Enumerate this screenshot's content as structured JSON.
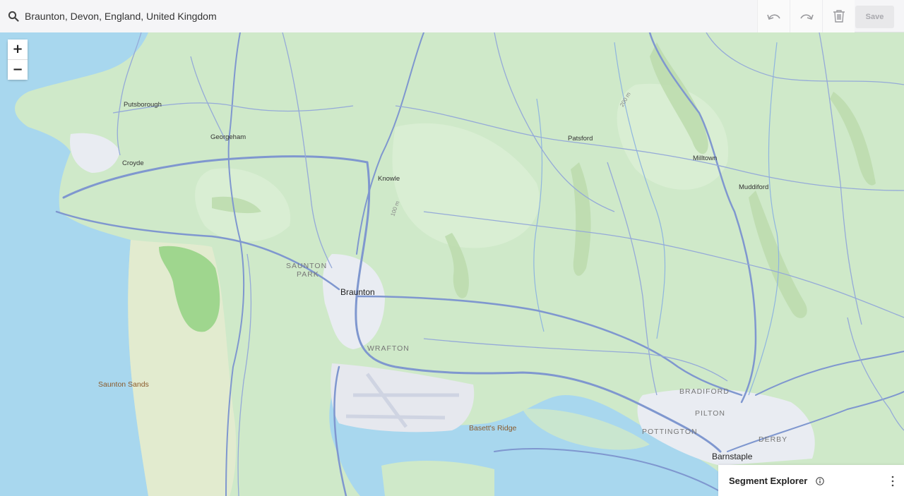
{
  "search": {
    "value": "Braunton, Devon, England, United Kingdom"
  },
  "toolbar": {
    "save_label": "Save"
  },
  "zoom": {
    "in_label": "+",
    "out_label": "−"
  },
  "segment_explorer": {
    "title": "Segment Explorer"
  },
  "map": {
    "places": [
      "Putsborough",
      "Georgeham",
      "Croyde",
      "Knowle",
      "Patsford",
      "Milltown",
      "Muddiford",
      "SAUNTON",
      "PARK",
      "Braunton",
      "WRAFTON",
      "Saunton Sands",
      "Basett's Ridge",
      "BRADIFORD",
      "PILTON",
      "POTTINGTON",
      "DERBY",
      "Barnstaple"
    ],
    "contours": [
      "200 m",
      "100 m"
    ]
  },
  "colors": {
    "land": "#cfe9c9",
    "water": "#a8d7ee",
    "road": "#7f97cf",
    "urban": "#e9ecf2",
    "forest": "#9fd68e"
  }
}
